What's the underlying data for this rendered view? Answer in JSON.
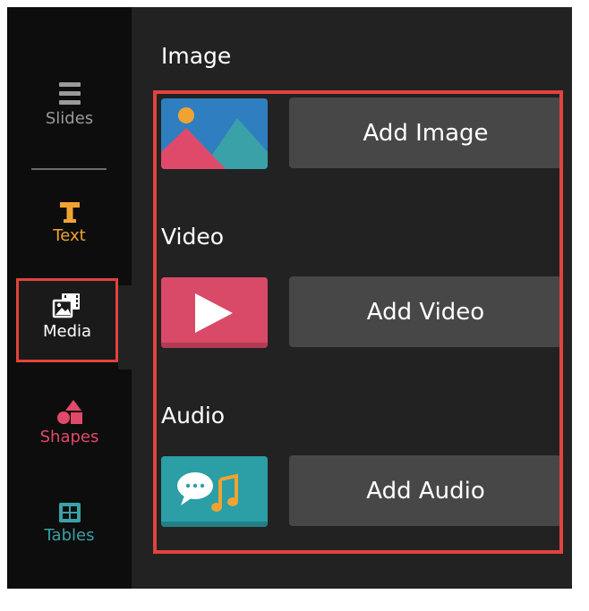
{
  "sidebar": {
    "items": [
      {
        "label": "Slides",
        "icon": "slides-icon",
        "color": "#9a9a9a"
      },
      {
        "label": "Text",
        "icon": "text-icon",
        "color": "#f0a331"
      },
      {
        "label": "Media",
        "icon": "media-icon",
        "color": "#ffffff",
        "active": true
      },
      {
        "label": "Shapes",
        "icon": "shapes-icon",
        "color": "#e04a6a"
      },
      {
        "label": "Tables",
        "icon": "tables-icon",
        "color": "#3aa1a8"
      }
    ]
  },
  "media": {
    "image": {
      "title": "Image",
      "button": "Add Image",
      "icon": "image-thumbnail-icon"
    },
    "video": {
      "title": "Video",
      "button": "Add Video",
      "icon": "video-thumbnail-icon"
    },
    "audio": {
      "title": "Audio",
      "button": "Add Audio",
      "icon": "audio-thumbnail-icon"
    }
  },
  "colors": {
    "highlight": "#e2433d",
    "panel_bg": "#222222",
    "sidebar_bg": "#0d0d0d",
    "button_bg": "#474747"
  }
}
